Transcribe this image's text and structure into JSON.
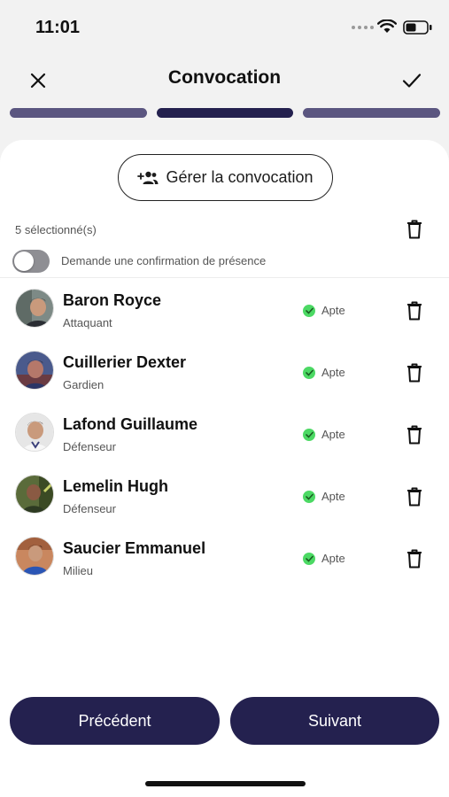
{
  "status_bar": {
    "time": "11:01"
  },
  "header": {
    "title": "Convocation",
    "close_icon": "close-icon",
    "confirm_icon": "check-icon"
  },
  "steps": {
    "count": 3,
    "active_index": 1
  },
  "manage": {
    "label": "Gérer la convocation",
    "icon": "add-group-icon"
  },
  "selection": {
    "count_label": "5 sélectionné(s)"
  },
  "presence_toggle": {
    "label": "Demande une confirmation de présence",
    "enabled": false
  },
  "players": [
    {
      "name": "Baron Royce",
      "role": "Attaquant",
      "status": "Apte"
    },
    {
      "name": "Cuillerier Dexter",
      "role": "Gardien",
      "status": "Apte"
    },
    {
      "name": "Lafond Guillaume",
      "role": "Défenseur",
      "status": "Apte"
    },
    {
      "name": "Lemelin Hugh",
      "role": "Défenseur",
      "status": "Apte"
    },
    {
      "name": "Saucier Emmanuel",
      "role": "Milieu",
      "status": "Apte"
    }
  ],
  "footer": {
    "prev_label": "Précédent",
    "next_label": "Suivant"
  },
  "colors": {
    "primary": "#24214f",
    "step_inactive": "#5b5680",
    "status_ok": "#4cd964"
  }
}
